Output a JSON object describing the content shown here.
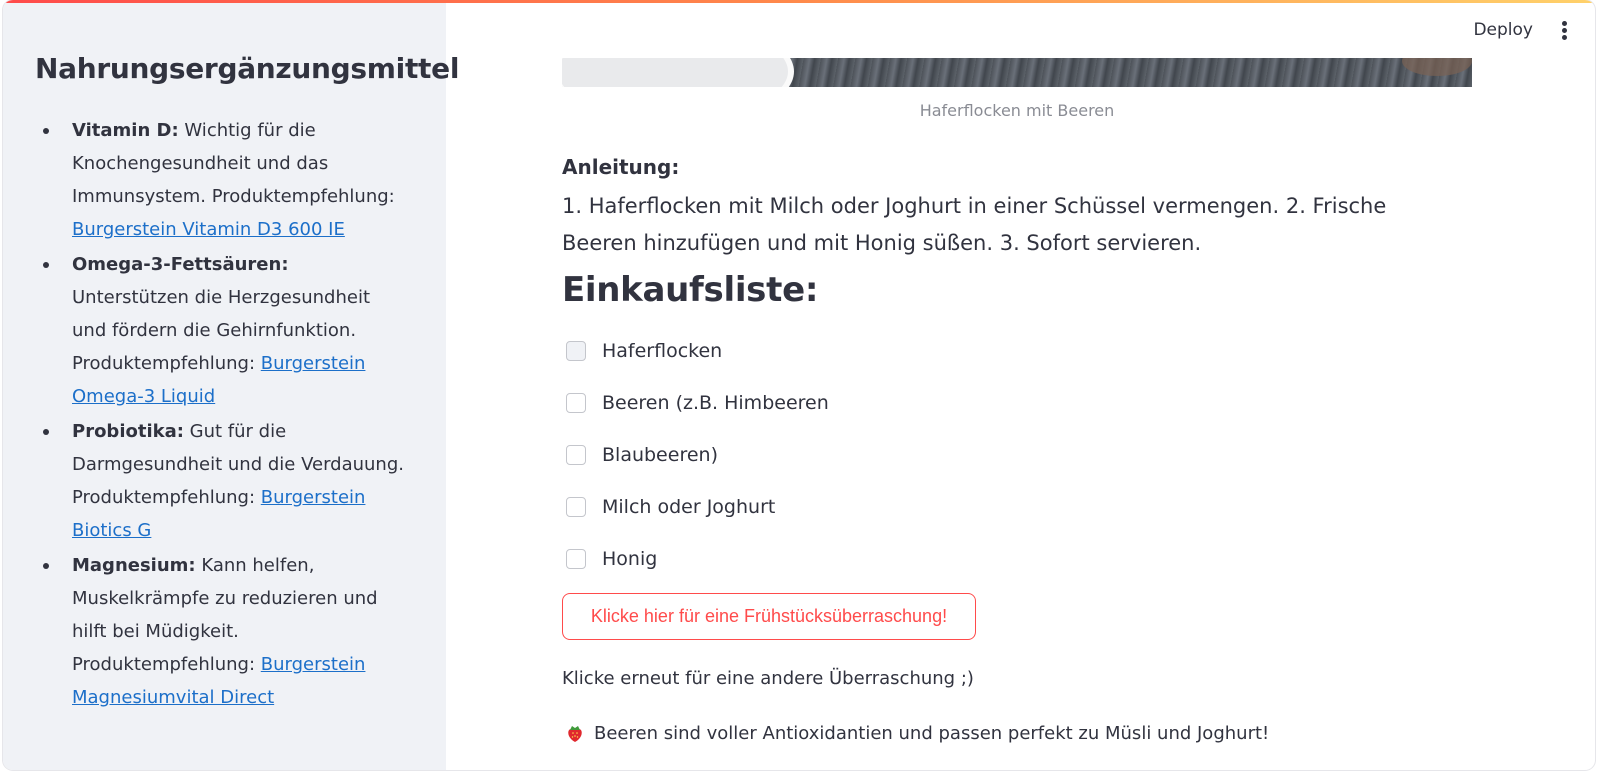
{
  "header": {
    "deploy_label": "Deploy",
    "menu_icon": "more-vertical-icon"
  },
  "sidebar": {
    "title": "Nahrungsergänzungsmittel",
    "items": [
      {
        "name": "Vitamin D:",
        "text": " Wichtig für die Knochengesundheit und das Immunsystem. Produktempfehlung: ",
        "link": "Burgerstein Vitamin D3 600 IE"
      },
      {
        "name": "Omega-3-Fettsäuren:",
        "text": " Unterstützen die Herzgesundheit und fördern die Gehirnfunktion. Produktempfehlung: ",
        "link": "Burgerstein Omega-3 Liquid"
      },
      {
        "name": "Probiotika:",
        "text": " Gut für die Darmgesundheit und die Verdauung. Produktempfehlung: ",
        "link": "Burgerstein Biotics G"
      },
      {
        "name": "Magnesium:",
        "text": " Kann helfen, Muskelkrämpfe zu reduzieren und hilft bei Müdigkeit. Produktempfehlung: ",
        "link": "Burgerstein Magnesiumvital Direct"
      }
    ]
  },
  "main": {
    "image_caption": "Haferflocken mit Beeren",
    "instructions_label": "Anleitung:",
    "instructions_text": "1. Haferflocken mit Milch oder Joghurt in einer Schüssel vermengen. 2. Frische Beeren hinzufügen und mit Honig süßen. 3. Sofort servieren.",
    "shopping_title": "Einkaufsliste:",
    "shopping_items": [
      {
        "label": "Haferflocken",
        "checked": false
      },
      {
        "label": "Beeren (z.B. Himbeeren",
        "checked": false
      },
      {
        "label": "Blaubeeren)",
        "checked": false
      },
      {
        "label": "Milch oder Joghurt",
        "checked": false
      },
      {
        "label": "Honig",
        "checked": false
      }
    ],
    "surprise_button": "Klicke hier für eine Frühstücksüberraschung!",
    "again_text": "Klicke erneut für eine andere Überraschung ;)",
    "tip_icon": "strawberry-icon",
    "tip_text": "Beeren sind voller Antioxidantien und passen perfekt zu Müsli und Joghurt!"
  },
  "colors": {
    "accent": "#ff4b4b",
    "link": "#1c6fc9",
    "text": "#31333f",
    "sidebar_bg": "#f0f2f6"
  }
}
